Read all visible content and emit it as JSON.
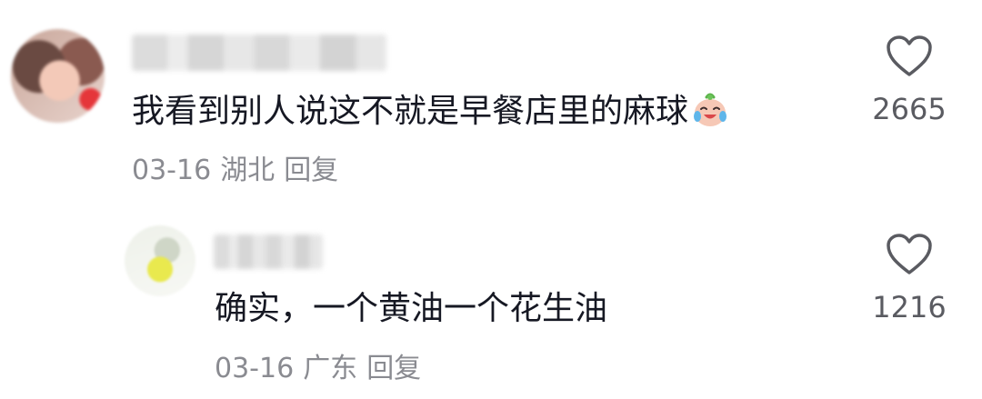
{
  "comment": {
    "username": "",
    "text": "我看到别人说这不就是早餐店里的麻球",
    "emoji": "crying-laughing-emoji",
    "date": "03-16",
    "location": "湖北",
    "reply_label": "回复",
    "like_icon": "heart-outline-icon",
    "like_count": "2665"
  },
  "reply": {
    "username": "",
    "text": "确实，一个黄油一个花生油",
    "date": "03-16",
    "location": "广东",
    "reply_label": "回复",
    "like_icon": "heart-outline-icon",
    "like_count": "1216"
  },
  "colors": {
    "text": "#161823",
    "meta": "#8a8b91",
    "count": "#5a5b61",
    "icon_stroke": "#5a5b61"
  }
}
